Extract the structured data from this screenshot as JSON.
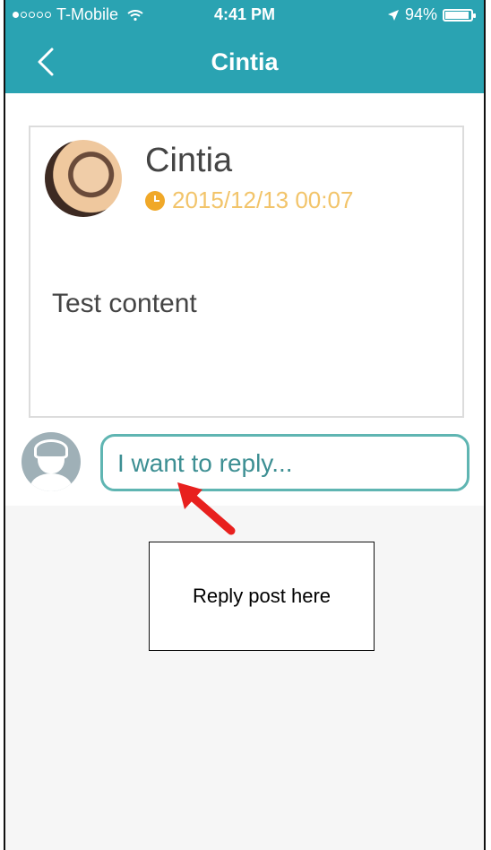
{
  "status_bar": {
    "carrier": "T-Mobile",
    "time": "4:41 PM",
    "battery": "94%",
    "battery_level": 0.94
  },
  "nav": {
    "title": "Cintia",
    "back_icon": "chevron-left-icon"
  },
  "post": {
    "author": "Cintia",
    "date": "2015/12/13 00:07",
    "body": "Test content"
  },
  "reply": {
    "placeholder": "I want to reply..."
  },
  "annotation": {
    "label": "Reply post here",
    "arrow_color": "#e8201e"
  },
  "colors": {
    "accent": "#2aa3b2",
    "date": "#f2c46a",
    "clock": "#f0a828"
  }
}
